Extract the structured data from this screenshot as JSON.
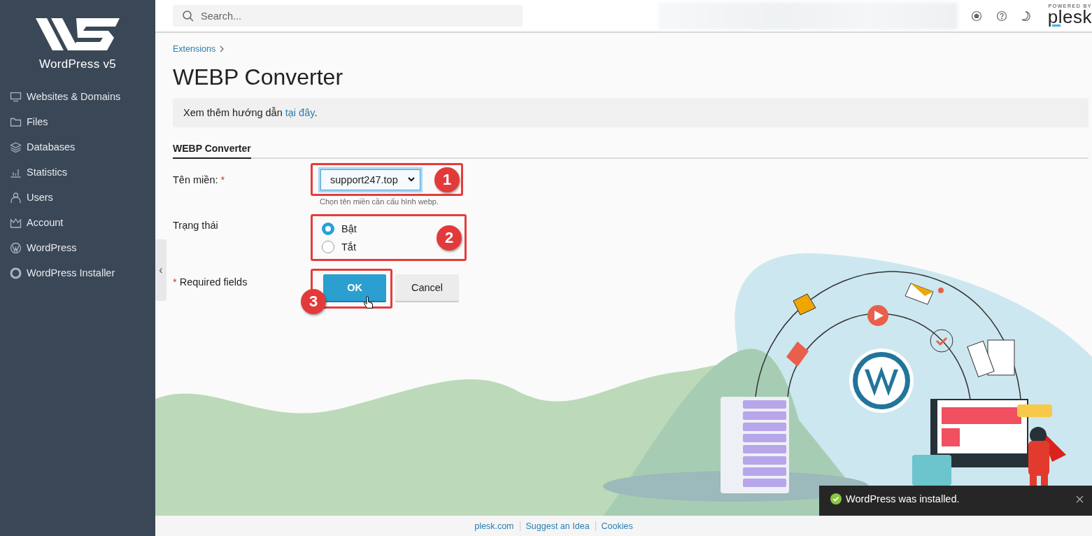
{
  "sidebar": {
    "brand": "WordPress v5",
    "items": [
      {
        "label": "Websites & Domains"
      },
      {
        "label": "Files"
      },
      {
        "label": "Databases"
      },
      {
        "label": "Statistics"
      },
      {
        "label": "Users"
      },
      {
        "label": "Account"
      },
      {
        "label": "WordPress"
      },
      {
        "label": "WordPress Installer"
      }
    ]
  },
  "header": {
    "search": {
      "placeholder": "Search..."
    },
    "powered_by": "POWERED BY",
    "logo": "plesk"
  },
  "collapse_handle": "‹",
  "breadcrumb": [
    "Extensions"
  ],
  "title": "WEBP Converter",
  "notice": {
    "text": "Xem thêm hướng dẫn",
    "link": "tại đây",
    "after": "."
  },
  "tabs": [
    {
      "label": "WEBP Converter",
      "selected": true
    }
  ],
  "form": {
    "domain": {
      "label": "Tên miền:",
      "required_mark": "*",
      "value": "support247.top",
      "hint": "Chọn tên miền cần cấu hình webp."
    },
    "status": {
      "label": "Trạng thái",
      "options": [
        {
          "label": "Bật",
          "selected": true
        },
        {
          "label": "Tắt",
          "selected": false
        }
      ]
    },
    "required_note": {
      "mark": "*",
      "text": "Required fields"
    },
    "buttons": [
      {
        "label": "OK",
        "kind": "primary"
      },
      {
        "label": "Cancel",
        "kind": "secondary"
      }
    ]
  },
  "annotations": [
    "1",
    "2",
    "3"
  ],
  "footer": {
    "links": [
      "plesk.com",
      "Suggest an Idea",
      "Cookies"
    ]
  },
  "toast": {
    "message": "WordPress was installed."
  }
}
